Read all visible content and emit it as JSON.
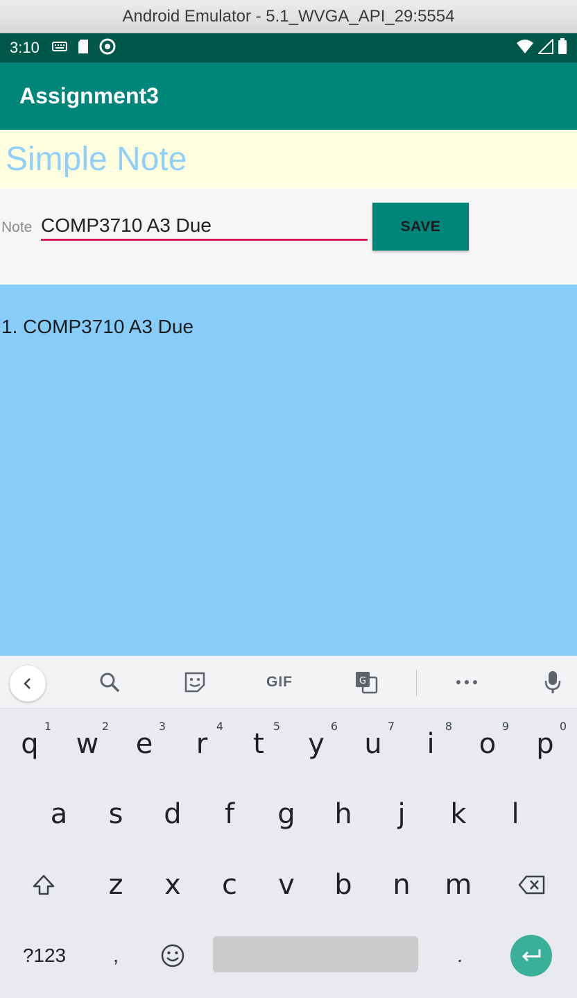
{
  "window": {
    "title": "Android Emulator - 5.1_WVGA_API_29:5554"
  },
  "status_bar": {
    "time": "3:10",
    "left_icons": [
      "keyboard-icon",
      "sd-card-icon",
      "sync-icon"
    ],
    "right_icons": [
      "wifi-icon",
      "cell-signal-icon",
      "battery-icon"
    ]
  },
  "app_bar": {
    "title": "Assignment3"
  },
  "header": {
    "title": "Simple Note"
  },
  "note_input": {
    "label": "Note",
    "value": "COMP3710  A3 Due"
  },
  "save_button": {
    "label": "SAVE"
  },
  "notes": [
    "1. COMP3710  A3 Due"
  ],
  "keyboard": {
    "toolbar": [
      "back-icon",
      "search-icon",
      "sticker-icon",
      "gif-icon",
      "translate-icon",
      "more-icon",
      "mic-icon"
    ],
    "gif_label": "GIF",
    "row1": [
      {
        "key": "q",
        "hint": "1"
      },
      {
        "key": "w",
        "hint": "2"
      },
      {
        "key": "e",
        "hint": "3"
      },
      {
        "key": "r",
        "hint": "4"
      },
      {
        "key": "t",
        "hint": "5"
      },
      {
        "key": "y",
        "hint": "6"
      },
      {
        "key": "u",
        "hint": "7"
      },
      {
        "key": "i",
        "hint": "8"
      },
      {
        "key": "o",
        "hint": "9"
      },
      {
        "key": "p",
        "hint": "0"
      }
    ],
    "row2": [
      "a",
      "s",
      "d",
      "f",
      "g",
      "h",
      "j",
      "k",
      "l"
    ],
    "row3": [
      "z",
      "x",
      "c",
      "v",
      "b",
      "n",
      "m"
    ],
    "symbols_label": "?123",
    "comma_label": ",",
    "period_label": ".",
    "accent_color": "#3ab09a"
  },
  "colors": {
    "status_bar": "#00584b",
    "app_bar": "#00857a",
    "header_band": "#fffede",
    "header_text": "#8fcff8",
    "input_underline": "#d81b60",
    "note_list": "#88cdf9"
  }
}
